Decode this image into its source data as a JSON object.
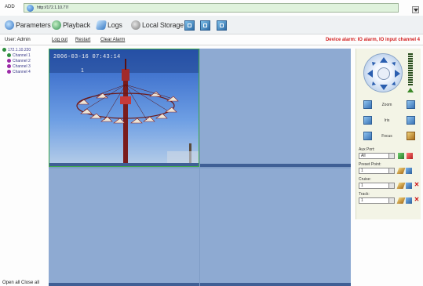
{
  "address": {
    "label": "ADD",
    "url": "http://172.1.10.77/"
  },
  "toolbar": {
    "parameters": "Parameters",
    "playback": "Playback",
    "logs": "Logs",
    "local_storage": "Local Storage"
  },
  "status": {
    "user_label": "User:",
    "user_name": "Admin",
    "logout": "Log out",
    "restart": "Restart",
    "clear_alarm": "Clear Alarm",
    "alarm_text": "Device alarm: IO alarm, IO input channel 4"
  },
  "tree": {
    "device": "172.1.10.220",
    "channels": [
      "Channel 1",
      "Channel 2",
      "Channel 3",
      "Channel 4"
    ]
  },
  "footer": {
    "open_all": "Open all",
    "close_all": "Close all"
  },
  "video": {
    "timestamp": "2006-03-16 07:43:14",
    "channel_label": "1"
  },
  "ptz": {
    "zoom": "Zoom",
    "iris": "Iris",
    "focus": "Focus",
    "aux_port_label": "Aux Port:",
    "aux_port_value": "All",
    "preset_label": "Preset Point:",
    "preset_value": "1",
    "cruise_label": "Cruise:",
    "cruise_value": "1",
    "track_label": "Track:",
    "track_value": "1"
  },
  "colors": {
    "accent": "#2f6fbf",
    "alarm": "#d21e1e",
    "grid": "#8eaad2",
    "selected_border": "#3fa84e"
  }
}
